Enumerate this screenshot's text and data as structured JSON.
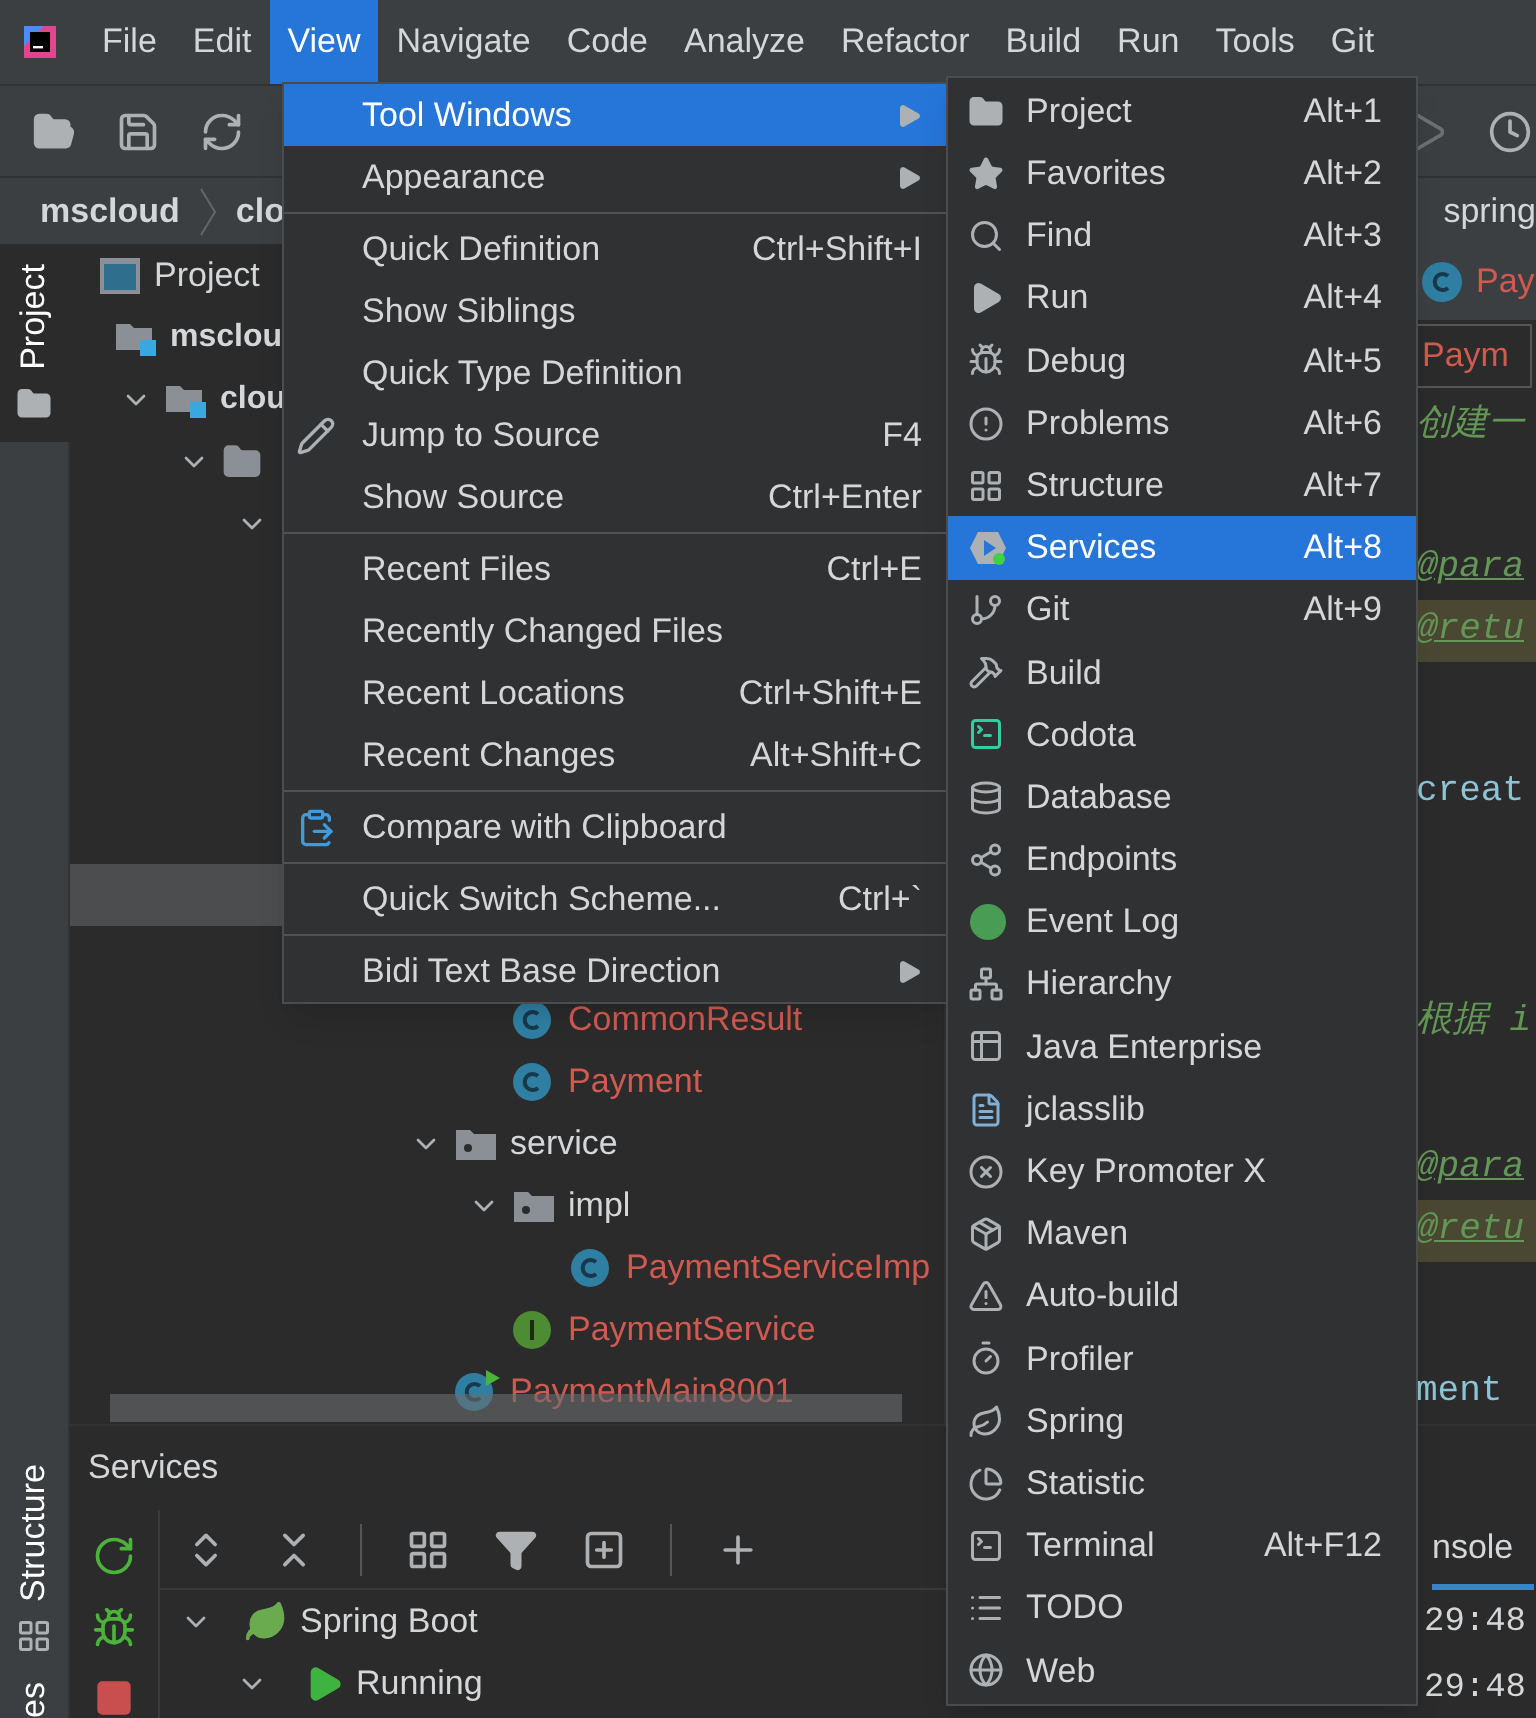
{
  "menu_bar": {
    "items": [
      {
        "label": "File",
        "selected": false
      },
      {
        "label": "Edit",
        "selected": false
      },
      {
        "label": "View",
        "selected": true
      },
      {
        "label": "Navigate",
        "selected": false
      },
      {
        "label": "Code",
        "selected": false
      },
      {
        "label": "Analyze",
        "selected": false
      },
      {
        "label": "Refactor",
        "selected": false
      },
      {
        "label": "Build",
        "selected": false
      },
      {
        "label": "Run",
        "selected": false
      },
      {
        "label": "Tools",
        "selected": false
      },
      {
        "label": "Git",
        "selected": false
      }
    ]
  },
  "breadcrumb": {
    "items": [
      "mscloud",
      "clo"
    ],
    "right": "spring"
  },
  "left_stripe": {
    "top_tabs": [
      {
        "label": "Project",
        "selected": true
      }
    ],
    "bottom_tabs": [
      {
        "label": "Structure",
        "selected": false
      },
      {
        "label": "es",
        "selected": false
      }
    ]
  },
  "project_panel": {
    "title": "Project",
    "tree": [
      {
        "label": "msclou",
        "kind": "module",
        "selected": false,
        "children": [
          {
            "label": "clou",
            "kind": "module",
            "expanded": true,
            "selected": false,
            "children": [
              {
                "kind": "folder",
                "expanded": true,
                "selected": false,
                "children": [
                  {
                    "expanded": true,
                    "selected": false,
                    "children": [
                      {
                        "selected": false,
                        "children": [
                          {
                            "selected": false,
                            "children": [
                              {
                                "selected": false
                              },
                              {
                                "selected": false,
                                "children": [
                                  {
                                    "selected": false
                                  }
                                ]
                              },
                              {
                                "selected": true
                              },
                              {
                                "selected": false,
                                "children": [
                                  {
                                    "label": "CommonResult",
                                    "kind": "class",
                                    "color": "#d05a50",
                                    "selected": false
                                  },
                                  {
                                    "label": "Payment",
                                    "kind": "class",
                                    "color": "#d05a50",
                                    "selected": false
                                  }
                                ]
                              },
                              {
                                "label": "service",
                                "kind": "package",
                                "expanded": true,
                                "selected": false,
                                "children": [
                                  {
                                    "label": "impl",
                                    "kind": "package",
                                    "expanded": true,
                                    "selected": false,
                                    "children": [
                                      {
                                        "label": "PaymentServiceImp",
                                        "kind": "class",
                                        "color": "#d05a50",
                                        "selected": false
                                      }
                                    ]
                                  },
                                  {
                                    "label": "PaymentService",
                                    "kind": "interface",
                                    "color": "#d05a50",
                                    "selected": false
                                  }
                                ]
                              },
                              {
                                "label": "PaymentMain8001",
                                "kind": "main_class",
                                "color": "#d05a50",
                                "selected": false
                              }
                            ]
                          }
                        ]
                      }
                    ]
                  }
                ]
              }
            ]
          }
        ]
      }
    ]
  },
  "editor": {
    "tab": "Pay",
    "popup": "Paym",
    "lines": [
      {
        "text": "创建一",
        "kind": "comment",
        "highlighted": false
      },
      {
        "text": "@para",
        "kind": "doc_tag",
        "highlighted": false
      },
      {
        "text": "@retu",
        "kind": "doc_tag",
        "highlighted": true
      },
      {
        "text": "creat",
        "kind": "code",
        "highlighted": false
      },
      {
        "text": "根据 i",
        "kind": "comment",
        "highlighted": false
      },
      {
        "text": "@para",
        "kind": "doc_tag",
        "highlighted": false
      },
      {
        "text": "@retu",
        "kind": "doc_tag",
        "highlighted": true
      },
      {
        "text": "ment",
        "kind": "code",
        "highlighted": false
      }
    ]
  },
  "services_panel": {
    "title": "Services",
    "tree": [
      {
        "label": "Spring Boot",
        "kind": "spring_boot",
        "expanded": true,
        "children": [
          {
            "label": "Running",
            "kind": "running",
            "expanded": true
          }
        ]
      }
    ],
    "console": {
      "tab": "nsole",
      "lines": [
        "29:48",
        "29:48"
      ]
    }
  },
  "view_menu": {
    "items": [
      {
        "kind": "item",
        "label": "Tool Windows",
        "submenu": true,
        "selected": true
      },
      {
        "kind": "item",
        "label": "Appearance",
        "submenu": true,
        "selected": false
      },
      {
        "kind": "separator"
      },
      {
        "kind": "item",
        "label": "Quick Definition",
        "shortcut": "Ctrl+Shift+I",
        "selected": false
      },
      {
        "kind": "item",
        "label": "Show Siblings",
        "selected": false
      },
      {
        "kind": "item",
        "label": "Quick Type Definition",
        "selected": false
      },
      {
        "kind": "item",
        "label": "Jump to Source",
        "shortcut": "F4",
        "selected": false
      },
      {
        "kind": "item",
        "label": "Show Source",
        "shortcut": "Ctrl+Enter",
        "selected": false
      },
      {
        "kind": "separator"
      },
      {
        "kind": "item",
        "label": "Recent Files",
        "shortcut": "Ctrl+E",
        "selected": false
      },
      {
        "kind": "item",
        "label": "Recently Changed Files",
        "selected": false
      },
      {
        "kind": "item",
        "label": "Recent Locations",
        "shortcut": "Ctrl+Shift+E",
        "selected": false
      },
      {
        "kind": "item",
        "label": "Recent Changes",
        "shortcut": "Alt+Shift+C",
        "selected": false
      },
      {
        "kind": "separator"
      },
      {
        "kind": "item",
        "label": "Compare with Clipboard",
        "selected": false
      },
      {
        "kind": "separator"
      },
      {
        "kind": "item",
        "label": "Quick Switch Scheme...",
        "shortcut": "Ctrl+`",
        "selected": false
      },
      {
        "kind": "separator"
      },
      {
        "kind": "item",
        "label": "Bidi Text Base Direction",
        "submenu": true,
        "selected": false
      }
    ]
  },
  "tool_windows_menu": {
    "items": [
      {
        "label": "Project",
        "shortcut": "Alt+1",
        "selected": false
      },
      {
        "label": "Favorites",
        "shortcut": "Alt+2",
        "selected": false
      },
      {
        "label": "Find",
        "shortcut": "Alt+3",
        "selected": false
      },
      {
        "label": "Run",
        "shortcut": "Alt+4",
        "selected": false
      },
      {
        "label": "Debug",
        "shortcut": "Alt+5",
        "selected": false
      },
      {
        "label": "Problems",
        "shortcut": "Alt+6",
        "selected": false
      },
      {
        "label": "Structure",
        "shortcut": "Alt+7",
        "selected": false
      },
      {
        "label": "Services",
        "shortcut": "Alt+8",
        "selected": true
      },
      {
        "label": "Git",
        "shortcut": "Alt+9",
        "selected": false
      },
      {
        "label": "Build",
        "selected": false
      },
      {
        "label": "Codota",
        "selected": false
      },
      {
        "label": "Database",
        "selected": false
      },
      {
        "label": "Endpoints",
        "selected": false
      },
      {
        "label": "Event Log",
        "selected": false
      },
      {
        "label": "Hierarchy",
        "selected": false
      },
      {
        "label": "Java Enterprise",
        "selected": false
      },
      {
        "label": "jclasslib",
        "selected": false
      },
      {
        "label": "Key Promoter X",
        "selected": false
      },
      {
        "label": "Maven",
        "selected": false
      },
      {
        "label": "Auto-build",
        "selected": false
      },
      {
        "label": "Profiler",
        "selected": false
      },
      {
        "label": "Spring",
        "selected": false
      },
      {
        "label": "Statistic",
        "selected": false
      },
      {
        "label": "Terminal",
        "shortcut": "Alt+F12",
        "selected": false
      },
      {
        "label": "TODO",
        "selected": false
      },
      {
        "label": "Web",
        "selected": false
      }
    ]
  }
}
